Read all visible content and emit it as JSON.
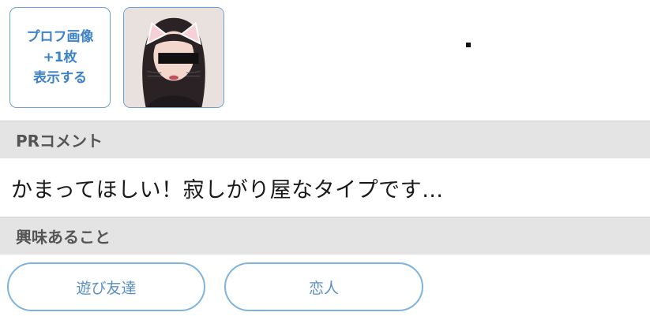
{
  "profile": {
    "more_photos_lines": [
      "プロフ画像",
      "+1枚",
      "表示する"
    ]
  },
  "pr": {
    "header": "PRコメント",
    "text": "かまってほしい！寂しがり屋なタイプです…"
  },
  "interests": {
    "header": "興味あること",
    "tags": [
      "遊び友達",
      "恋人"
    ]
  },
  "colors": {
    "accent": "#3c82c8",
    "chip_border": "#7eb3de",
    "section_bg": "#e4e4e4"
  }
}
